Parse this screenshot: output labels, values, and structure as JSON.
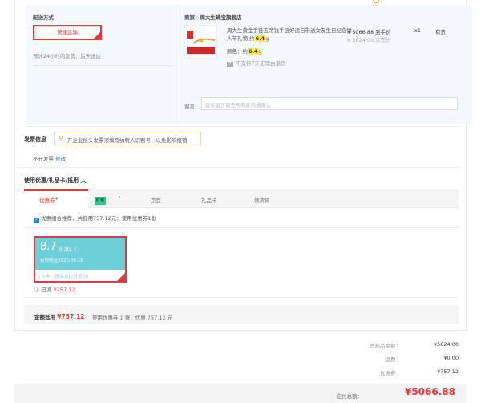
{
  "shipping": {
    "title": "配送方式",
    "method": "快速运输",
    "note": "预计24小时内发货、后天送达"
  },
  "product": {
    "store": "商家：周大生珠宝旗舰店",
    "name_prefix": "周大生黄金手链五帝钱手链好运自带送女友生日纪念情人节礼物 约",
    "weight_hl": "6.4",
    "weight_unit": "g",
    "price": "¥ 5066.88 到手价",
    "price_orig": "¥ 5824.00 京东价",
    "qty": "x1",
    "stock": "有货",
    "color_label": "颜色：",
    "color_prefix": "约",
    "color_hl": "6.4",
    "color_unit": "g",
    "return_note": "不支持7天无理由退货"
  },
  "memo": {
    "label": "留言:",
    "placeholder": "建议留言前先与商家沟通确认"
  },
  "invoice": {
    "title": "发票信息",
    "tip": "开企业抬头发票须填写纳税人识别号，以免影响报销",
    "status": "不开发票",
    "modify": "修改"
  },
  "coupons": {
    "title": "使用优惠/礼品卡/抵用 ︿",
    "tabs": [
      "优惠券",
      "红包",
      "京豆",
      "礼品卡",
      "领货码"
    ],
    "auto_text": "优惠组合推荐，共抵用757.12元；使用优惠券1张",
    "card": {
      "value": "8.7",
      "unit": "折",
      "tag": "满1 ⓘ",
      "expiry": "有效期至2025-06-18",
      "links": "[东券]  [限品类]  [可叠加]"
    },
    "used_label": "ⓘ 已减",
    "used_amount": "¥757.12",
    "deduct_label": "金额抵用",
    "deduct_amount": "¥757.12",
    "deduct_note": "使用优惠券 1 张，优惠 757.12 元"
  },
  "totals": {
    "goods_label": "总商品金额：",
    "goods": "¥5824.00",
    "ship_label": "运费：",
    "ship": "¥0.00",
    "coupon_label": "优惠券：",
    "coupon": "-¥757.12",
    "pay_label": "应付总额：",
    "pay": "¥5066.88"
  },
  "colors": {
    "accent": "#e4393c",
    "coupon_bg": "#6dcfd8",
    "highlight": "#ffe44d",
    "hongbao": "#30c78c"
  }
}
